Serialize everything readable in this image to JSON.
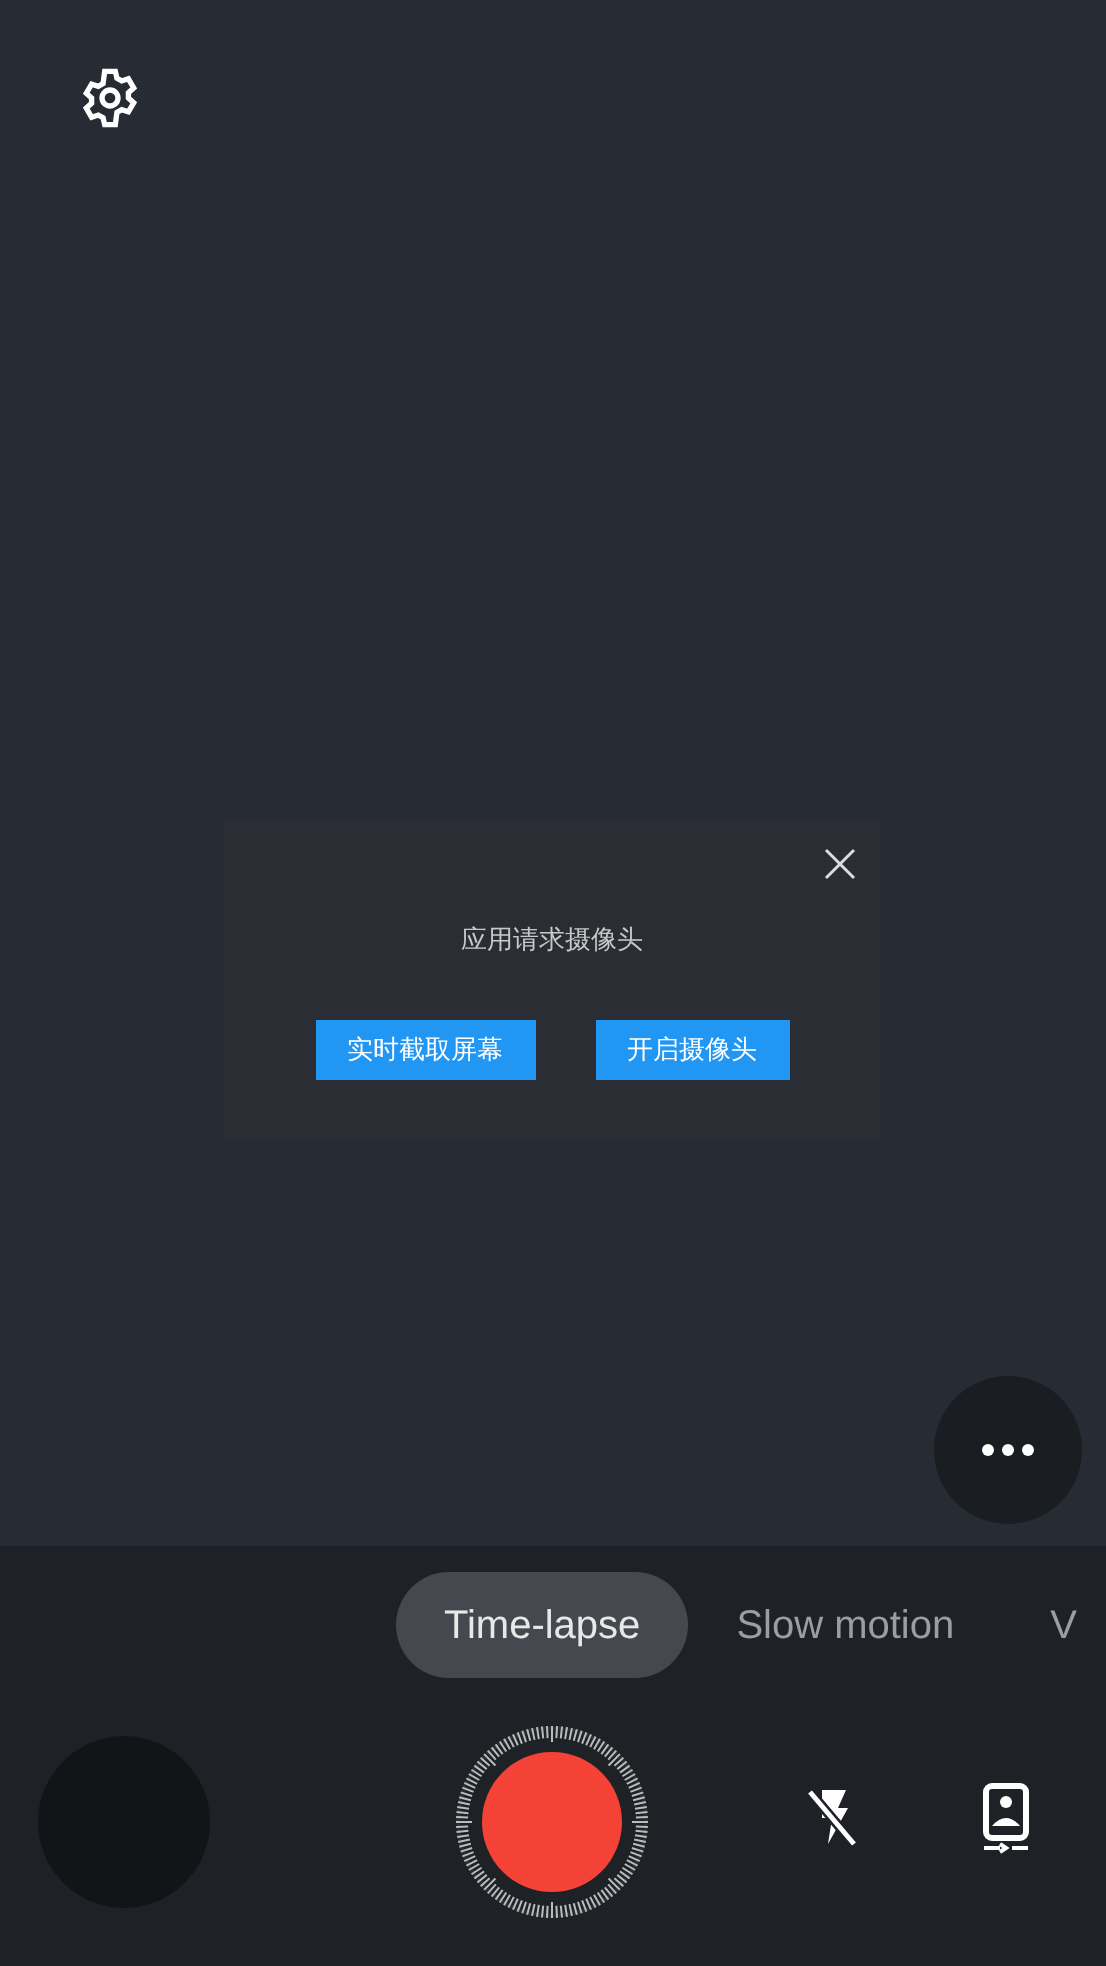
{
  "dialog": {
    "message": "应用请求摄像头",
    "buttons": [
      {
        "label": "实时截取屏幕"
      },
      {
        "label": "开启摄像头"
      }
    ]
  },
  "modes": [
    {
      "label": "Time-lapse",
      "selected": true
    },
    {
      "label": "Slow motion",
      "selected": false
    },
    {
      "label": "V",
      "selected": false
    }
  ],
  "flash": {
    "on": false
  }
}
